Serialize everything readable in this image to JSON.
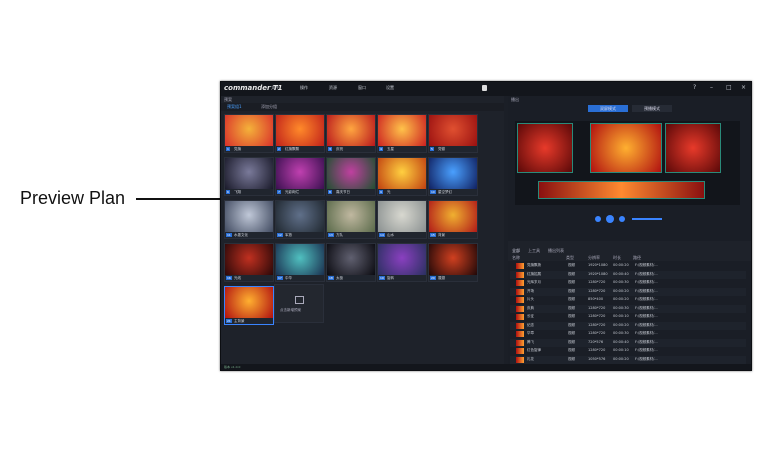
{
  "callout": {
    "label": "Preview Plan"
  },
  "app": {
    "title": "commander T1",
    "menus": [
      "文件",
      "操作",
      "资源",
      "窗口",
      "设置"
    ],
    "left_panel": {
      "title": "预案",
      "tabs": [
        "预案组1",
        "添加分组"
      ],
      "thumbs": [
        {
          "num": "1",
          "name": "党旗",
          "c1": "#d9302a",
          "c2": "#f4b23a"
        },
        {
          "num": "2",
          "name": "红旗飘飘",
          "c1": "#c0201a",
          "c2": "#ff8a2a"
        },
        {
          "num": "3",
          "name": "庆祝",
          "c1": "#b8161c",
          "c2": "#ffa640"
        },
        {
          "num": "4",
          "name": "五星",
          "c1": "#cc2020",
          "c2": "#ffc34a"
        },
        {
          "num": "5",
          "name": "党徽",
          "c1": "#9a1010",
          "c2": "#e05030"
        },
        {
          "num": "6",
          "name": "飞翔",
          "c1": "#1a1a2a",
          "c2": "#7a7a9a"
        },
        {
          "num": "7",
          "name": "光影绚烂",
          "c1": "#3a1050",
          "c2": "#c040b0"
        },
        {
          "num": "8",
          "name": "喜庆节日",
          "c1": "#205030",
          "c2": "#c040a0"
        },
        {
          "num": "9",
          "name": "光",
          "c1": "#c04010",
          "c2": "#ffd040"
        },
        {
          "num": "10",
          "name": "星空梦幻",
          "c1": "#102060",
          "c2": "#4aa0ff"
        },
        {
          "num": "11",
          "name": "水墨文化",
          "c1": "#404a60",
          "c2": "#c0c8d8"
        },
        {
          "num": "12",
          "name": "军旅",
          "c1": "#202830",
          "c2": "#60708a"
        },
        {
          "num": "13",
          "name": "方队",
          "c1": "#5a6a4a",
          "c2": "#c0b8a0"
        },
        {
          "num": "14",
          "name": "山水",
          "c1": "#8a9090",
          "c2": "#d8d8d0"
        },
        {
          "num": "15",
          "name": "背景",
          "c1": "#b01a18",
          "c2": "#f0b030"
        },
        {
          "num": "16",
          "name": "光线",
          "c1": "#2a0808",
          "c2": "#c03020"
        },
        {
          "num": "17",
          "name": "中华",
          "c1": "#1a3050",
          "c2": "#50c0c0"
        },
        {
          "num": "18",
          "name": "太极",
          "c1": "#0a0a10",
          "c2": "#606070"
        },
        {
          "num": "19",
          "name": "旋转",
          "c1": "#2a3060",
          "c2": "#8a40c0"
        },
        {
          "num": "20",
          "name": "展翅",
          "c1": "#200808",
          "c2": "#d04020"
        },
        {
          "num": "21",
          "name": "主背景",
          "c1": "#b01010",
          "c2": "#ffb030"
        }
      ],
      "add_label": "点击新增预案"
    },
    "right_panel": {
      "title": "播出",
      "modes": [
        "双屏模式",
        "预播模式"
      ],
      "list_tabs": [
        "全部",
        "上工具",
        "播出列表"
      ],
      "columns": [
        "名称",
        "类型",
        "分辨率",
        "时长",
        "路径"
      ],
      "rows": [
        {
          "name": "党旗飘扬",
          "type": "视频",
          "res": "1920*1080",
          "dur": "00:00:20",
          "path": "F:/视频素材/..."
        },
        {
          "name": "红旗招展",
          "type": "视频",
          "res": "1920*1080",
          "dur": "00:00:40",
          "path": "F:/视频素材/..."
        },
        {
          "name": "光辉岁月",
          "type": "视频",
          "res": "1280*720",
          "dur": "00:00:30",
          "path": "F:/视频素材/..."
        },
        {
          "name": "开场",
          "type": "视频",
          "res": "1280*720",
          "dur": "00:00:20",
          "path": "F:/视频素材/..."
        },
        {
          "name": "片头",
          "type": "视频",
          "res": "850*400",
          "dur": "00:00:20",
          "path": "F:/视频素材/..."
        },
        {
          "name": "庆典",
          "type": "视频",
          "res": "1280*720",
          "dur": "00:00:30",
          "path": "F:/视频素材/..."
        },
        {
          "name": "长征",
          "type": "视频",
          "res": "1280*720",
          "dur": "00:00:10",
          "path": "F:/视频素材/..."
        },
        {
          "name": "纪念",
          "type": "视频",
          "res": "1280*720",
          "dur": "00:00:20",
          "path": "F:/视频素材/..."
        },
        {
          "name": "华章",
          "type": "视频",
          "res": "1280*720",
          "dur": "00:00:30",
          "path": "F:/视频素材/..."
        },
        {
          "name": "腾飞",
          "type": "视频",
          "res": "720*576",
          "dur": "00:00:40",
          "path": "F:/视频素材/..."
        },
        {
          "name": "红色旋律",
          "type": "视频",
          "res": "1280*720",
          "dur": "00:00:10",
          "path": "F:/视频素材/..."
        },
        {
          "name": "礼花",
          "type": "视频",
          "res": "1050*576",
          "dur": "00:00:20",
          "path": "F:/视频素材/..."
        }
      ]
    },
    "status": "版本 v1.0.0"
  }
}
